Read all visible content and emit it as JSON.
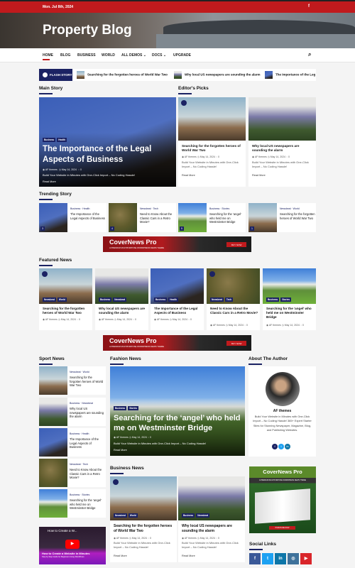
{
  "topbar": {
    "date": "Mon. Jul 8th, 2024",
    "facebook_icon": "f"
  },
  "site": {
    "title": "Property Blog"
  },
  "nav": {
    "items": [
      "HOME",
      "BLOG",
      "BUSINESS",
      "WORLD",
      "ALL DEMOS ⌄",
      "DOCS ⌄",
      "UPGRADE"
    ],
    "search_icon": "⌕"
  },
  "flash": {
    "label": "FLASH STORY",
    "items": [
      "Searching for the forgotten heroes of World War Two",
      "Why local US newspapers are sounding the alarm",
      "The Importance of the Leg"
    ]
  },
  "common": {
    "author": "AF themes",
    "date": "May 14, 2024",
    "comments": "0",
    "excerpt": "Build Your Website in Minutes with One-Click Import – No Coding Hassle!",
    "read_more": "Read More"
  },
  "main_story": {
    "heading": "Main Story",
    "tags": [
      "Business",
      "Health"
    ],
    "title": "The Importance of the Legal Aspects of Business"
  },
  "editors_picks": {
    "heading": "Editor's Picks",
    "items": [
      {
        "title": "Searching for the forgotten heroes of World War Two"
      },
      {
        "title": "Why local US newspapers are sounding the alarm"
      }
    ]
  },
  "trending": {
    "heading": "Trending Story",
    "items": [
      {
        "num": "3",
        "cats": "Business · Health",
        "title": "The Importance of the Legal Aspects of Business"
      },
      {
        "num": "4",
        "cats": "Newsbeat · Tech",
        "title": "Need to Know About the Classic Cars in a Retro Movie?"
      },
      {
        "num": "5",
        "cats": "Business · Stories",
        "title": "Searching for the 'angel' who held me on Westminster Bridge"
      },
      {
        "num": "1",
        "cats": "Newsbeat · World",
        "title": "Searching for the forgotten heroes of World War Two"
      }
    ]
  },
  "ad": {
    "name": "CoverNews Pro",
    "sub": "A PREMIUM MULTIPURPOSE WORDPRESS NEWS THEME",
    "button": "BUY NOW",
    "side_button": "PURCHASE NOW"
  },
  "featured": {
    "heading": "Featured News",
    "items": [
      {
        "tags": [
          "Newsbeat",
          "World"
        ],
        "title": "Searching for the forgotten heroes of World War Two"
      },
      {
        "tags": [
          "Business",
          "Newsbeat"
        ],
        "title": "Why local US newspapers are sounding the alarm"
      },
      {
        "tags": [
          "Business",
          "Health"
        ],
        "title": "The Importance of the Legal Aspects of Business"
      },
      {
        "tags": [
          "Newsbeat",
          "Tech"
        ],
        "title": "Need to Know About the Classic Cars in a Retro Movie?"
      },
      {
        "tags": [
          "Business",
          "Stories"
        ],
        "title": "Searching for the 'angel' who held me on Westminster Bridge"
      }
    ]
  },
  "sport": {
    "heading": "Sport News",
    "items": [
      {
        "cats": "Newsbeat · World",
        "title": "Searching for the forgotten heroes of World War Two"
      },
      {
        "cats": "Business · Newsbeat",
        "title": "Why local US newspapers are sounding the alarm"
      },
      {
        "cats": "Business · Health",
        "title": "The Importance of the Legal Aspects of Business"
      },
      {
        "cats": "Newsbeat · Tech",
        "title": "Need to Know About the Classic Cars in a Retro Movie?"
      },
      {
        "cats": "Business · Stories",
        "title": "Searching for the 'angel' who held me on Westminster Bridge"
      }
    ],
    "video_title": "How to Create a W...",
    "video_caption": "How to Create a Website in Minutes",
    "video_sub": "Step by Step Guide for Beginners Using WordPress"
  },
  "fashion": {
    "heading": "Fashion News",
    "tags": [
      "Business",
      "Stories"
    ],
    "title": "Searching for the ‘angel’ who held me on Westminster Bridge"
  },
  "business": {
    "heading": "Business News",
    "items": [
      {
        "tags": [
          "Newsbeat",
          "World"
        ],
        "title": "Searching for the forgotten heroes of World War Two"
      },
      {
        "tags": [
          "Business",
          "Newsbeat"
        ],
        "title": "Why local US newspapers are sounding the alarm"
      }
    ]
  },
  "author": {
    "heading": "About The Author",
    "name": "AF themes",
    "bio": "Build Your Website in Minutes with One-Click Import – No Coding Hassle! 365+ Expert Starter Sites for Stunning Newspaper, Magazine, Blog, and Publishing Websites."
  },
  "social": {
    "heading": "Social Links",
    "items": [
      {
        "icon": "f",
        "color": "#3b5998"
      },
      {
        "icon": "t",
        "color": "#1da1f2"
      },
      {
        "icon": "in",
        "color": "#0e76a8"
      },
      {
        "icon": "◎",
        "color": "#3f729b"
      },
      {
        "icon": "▶",
        "color": "#d9252a"
      }
    ]
  },
  "colors": {
    "brand_red": "#c01a1d",
    "navy": "#1b2263"
  }
}
